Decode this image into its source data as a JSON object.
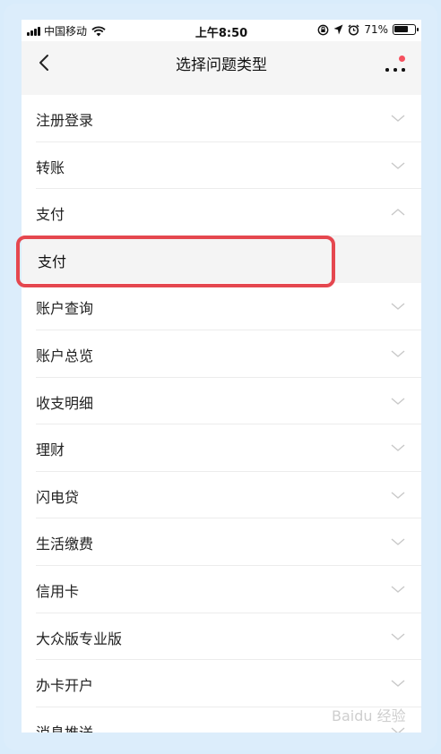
{
  "status_bar": {
    "carrier": "中国移动",
    "time": "上午8:50",
    "battery": "71%",
    "battery_level": 0.71
  },
  "nav": {
    "title": "选择问题类型"
  },
  "list": [
    {
      "label": "注册登录",
      "chevron": "down"
    },
    {
      "label": "转账",
      "chevron": "down"
    },
    {
      "label": "支付",
      "chevron": "up"
    },
    {
      "label": "支付",
      "sub": true
    },
    {
      "label": "账户查询",
      "chevron": "down"
    },
    {
      "label": "账户总览",
      "chevron": "down"
    },
    {
      "label": "收支明细",
      "chevron": "down"
    },
    {
      "label": "理财",
      "chevron": "down"
    },
    {
      "label": "闪电贷",
      "chevron": "down"
    },
    {
      "label": "生活缴费",
      "chevron": "down"
    },
    {
      "label": "信用卡",
      "chevron": "down"
    },
    {
      "label": "大众版专业版",
      "chevron": "down"
    },
    {
      "label": "办卡开户",
      "chevron": "down"
    },
    {
      "label": "消息推送",
      "chevron": "down"
    }
  ],
  "watermark": "Baidu 经验",
  "colors": {
    "highlight": "#e5474f",
    "notification_dot": "#f5515f",
    "background": "#dcedfb"
  }
}
